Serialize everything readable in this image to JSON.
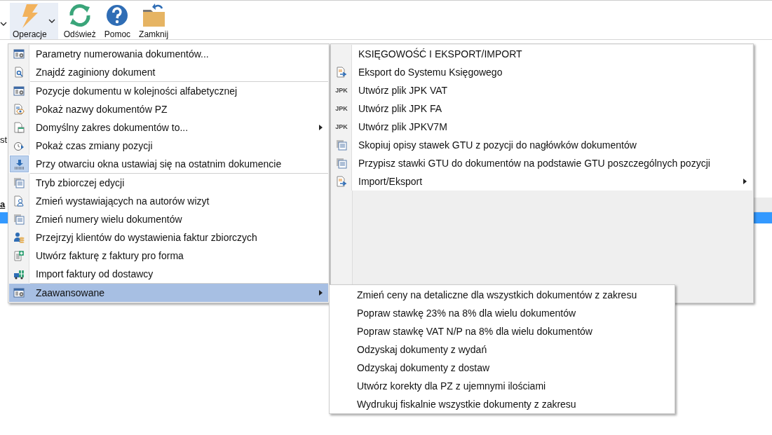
{
  "toolbar": {
    "buttons": [
      {
        "label": "Operacje",
        "selected": true,
        "dropdown": true
      },
      {
        "label": "Odśwież",
        "selected": false,
        "dropdown": false
      },
      {
        "label": "Pomoc",
        "selected": false,
        "dropdown": false
      },
      {
        "label": "Zamknij",
        "selected": false,
        "dropdown": false
      }
    ]
  },
  "background": {
    "left_fragments": [
      "st",
      "a"
    ]
  },
  "operations_menu": {
    "items": [
      {
        "kind": "item",
        "label": "Parametry numerowania dokumentów...",
        "checked": false,
        "submenu": false,
        "selected": false
      },
      {
        "kind": "item",
        "label": "Znajdź zaginiony dokument",
        "checked": false,
        "submenu": false,
        "selected": false
      },
      {
        "kind": "separator"
      },
      {
        "kind": "item",
        "label": "Pozycje dokumentu w kolejności alfabetycznej",
        "checked": false,
        "submenu": false,
        "selected": false
      },
      {
        "kind": "item",
        "label": "Pokaż nazwy dokumentów PZ",
        "checked": false,
        "submenu": false,
        "selected": false
      },
      {
        "kind": "item",
        "label": "Domyślny zakres dokumentów to...",
        "checked": false,
        "submenu": true,
        "selected": false
      },
      {
        "kind": "item",
        "label": "Pokaż czas zmiany pozycji",
        "checked": false,
        "submenu": false,
        "selected": false
      },
      {
        "kind": "item",
        "label": "Przy otwarciu okna ustawiaj się na ostatnim dokumencie",
        "checked": true,
        "submenu": false,
        "selected": false
      },
      {
        "kind": "separator"
      },
      {
        "kind": "item",
        "label": "Tryb zbiorczej edycji",
        "checked": false,
        "submenu": false,
        "selected": false
      },
      {
        "kind": "item",
        "label": "Zmień wystawiających na autorów wizyt",
        "checked": false,
        "submenu": false,
        "selected": false
      },
      {
        "kind": "item",
        "label": "Zmień numery wielu dokumentów",
        "checked": false,
        "submenu": false,
        "selected": false
      },
      {
        "kind": "item",
        "label": "Przejrzyj klientów do wystawienia faktur zbiorczych",
        "checked": false,
        "submenu": false,
        "selected": false
      },
      {
        "kind": "item",
        "label": "Utwórz fakturę z faktury pro forma",
        "checked": false,
        "submenu": false,
        "selected": false
      },
      {
        "kind": "item",
        "label": "Import faktury od dostawcy",
        "checked": false,
        "submenu": false,
        "selected": false
      },
      {
        "kind": "separator"
      },
      {
        "kind": "item",
        "label": "Zaawansowane",
        "checked": false,
        "submenu": true,
        "selected": true
      }
    ]
  },
  "accounting_menu": {
    "header": "KSIĘGOWOŚĆ I EKSPORT/IMPORT",
    "items": [
      {
        "label": "Eksport do Systemu Księgowego",
        "submenu": false
      },
      {
        "label": "Utwórz plik JPK VAT",
        "icon_text": "JPK",
        "submenu": false
      },
      {
        "label": "Utwórz plik JPK FA",
        "icon_text": "JPK",
        "submenu": false
      },
      {
        "label": "Utwórz plik JPKV7M",
        "icon_text": "JPK",
        "submenu": false
      },
      {
        "label": "Skopiuj opisy stawek GTU z pozycji do nagłówków dokumentów",
        "submenu": false
      },
      {
        "label": "Przypisz stawki GTU do dokumentów na podstawie GTU poszczególnych pozycji",
        "submenu": false
      },
      {
        "label": "Import/Eksport",
        "submenu": true
      }
    ]
  },
  "advanced_submenu": {
    "items": [
      "Zmień ceny na detaliczne dla wszystkich dokumentów z zakresu",
      "Popraw stawkę 23% na 8% dla wielu dokumentów",
      "Popraw stawkę VAT N/P na 8% dla wielu dokumentów",
      "Odzyskaj dokumenty z wydań",
      "Odzyskaj dokumenty z dostaw",
      "Utwórz korekty dla PZ z ujemnymi ilościami",
      "Wydrukuj fiskalnie wszystkie dokumenty z zakresu"
    ]
  }
}
